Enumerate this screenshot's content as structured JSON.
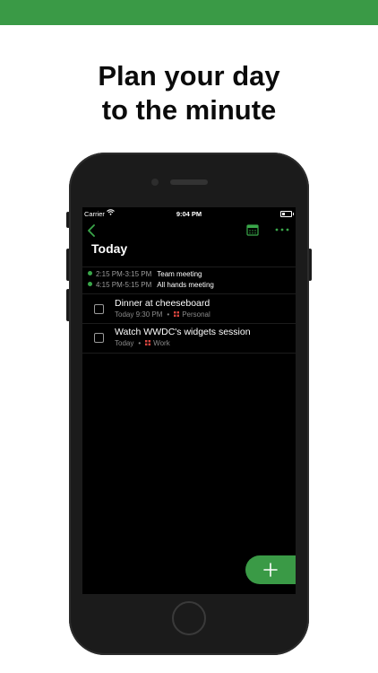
{
  "promo": {
    "headline_line1": "Plan your day",
    "headline_line2": "to the minute"
  },
  "status_bar": {
    "carrier": "Carrier",
    "time": "9:04 PM"
  },
  "nav": {
    "title": "Today"
  },
  "events": [
    {
      "time": "2:15 PM-3:15 PM",
      "name": "Team meeting"
    },
    {
      "time": "4:15 PM-5:15 PM",
      "name": "All hands meeting"
    }
  ],
  "tasks": [
    {
      "title": "Dinner at cheeseboard",
      "when": "Today 9:30 PM",
      "separator": "•",
      "project": "Personal"
    },
    {
      "title": "Watch WWDC's widgets session",
      "when": "Today",
      "separator": "•",
      "project": "Work"
    }
  ],
  "colors": {
    "accent_green": "#3a9a46",
    "event_dot": "#3aa74a",
    "project_icon": "#d9453f"
  },
  "icons": {
    "back": "chevron-left-icon",
    "calendar": "calendar-icon",
    "more": "more-dots-icon",
    "add": "plus-icon",
    "project": "grid-icon"
  }
}
